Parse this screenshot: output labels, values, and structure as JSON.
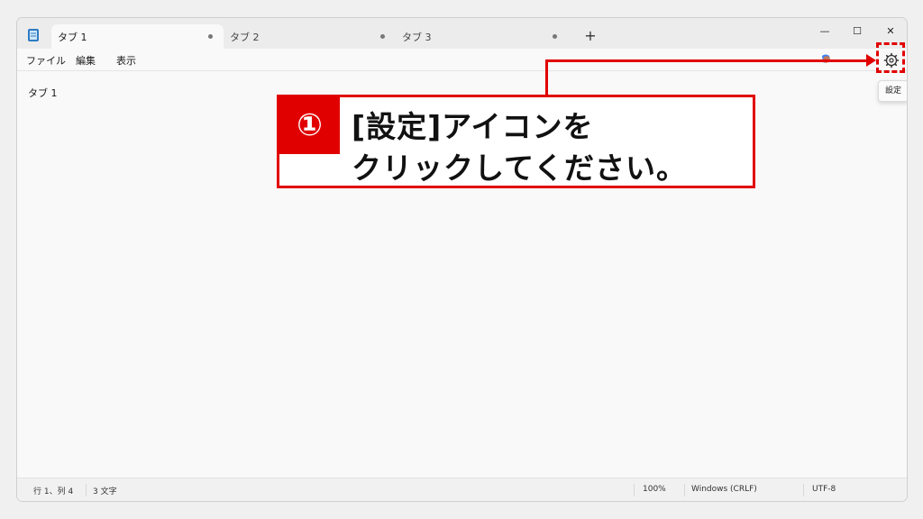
{
  "tabs": [
    {
      "label": "タブ 1",
      "active": true
    },
    {
      "label": "タブ 2",
      "active": false
    },
    {
      "label": "タブ 3",
      "active": false
    }
  ],
  "new_tab_label": "+",
  "window_controls": {
    "minimize": "—",
    "maximize": "☐",
    "close": "✕"
  },
  "menu": {
    "file": "ファイル",
    "edit": "編集",
    "view": "表示"
  },
  "editor": {
    "content": "タブ 1"
  },
  "tooltip": {
    "settings": "設定"
  },
  "status": {
    "position": "行 1、列 4",
    "chars": "3 文字",
    "zoom": "100%",
    "line_ending": "Windows (CRLF)",
    "encoding": "UTF-8"
  },
  "annotation": {
    "step": "①",
    "line1": "[設定]アイコンを",
    "line2": "クリックしてください。"
  },
  "colors": {
    "accent_red": "#e10000"
  },
  "icons": {
    "app": "notepad-icon",
    "copilot": "copilot-icon",
    "settings": "gear-icon"
  }
}
